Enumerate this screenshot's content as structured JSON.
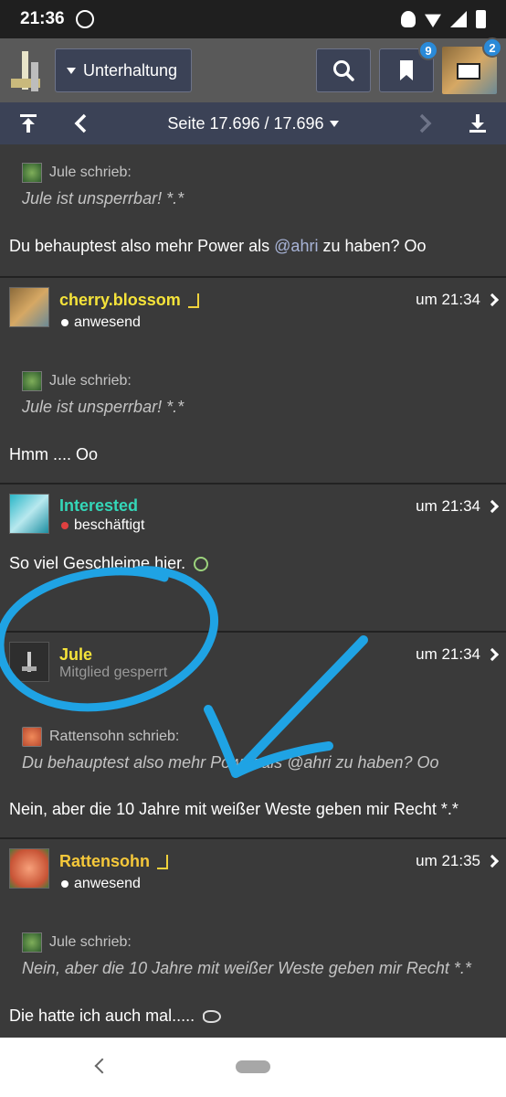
{
  "status_bar": {
    "time": "21:36"
  },
  "top_bar": {
    "forum": "Unterhaltung",
    "bookmark_badge": "9",
    "message_badge": "2"
  },
  "pager": {
    "page_label": "Seite 17.696 / 17.696"
  },
  "posts": [
    {
      "quote_author": "Jule schrieb:",
      "quote_text": "Jule ist unsperrbar! *.*",
      "text_before": "Du behauptest also mehr Power als ",
      "mention": "@ahri",
      "text_after": " zu haben? Oo"
    },
    {
      "user": "cherry.blossom",
      "user_color": "#f5e33a",
      "status": "anwesend",
      "time": "um 21:34",
      "quote_author": "Jule schrieb:",
      "quote_text": "Jule ist unsperrbar! *.*",
      "text": "Hmm .... Oo"
    },
    {
      "user": "Interested",
      "user_color": "#34d6b8",
      "status": "beschäftigt",
      "time": "um 21:34",
      "text": "So viel Geschleime hier."
    },
    {
      "user": "Jule",
      "user_color": "#f5e33a",
      "status": "Mitglied gesperrt",
      "time": "um 21:34",
      "quote_author": "Rattensohn schrieb:",
      "quote_text": "Du behauptest also mehr Power als @ahri zu haben? Oo",
      "text": "Nein, aber die 10 Jahre mit weißer Weste geben mir Recht *.*"
    },
    {
      "user": "Rattensohn",
      "user_color": "#f5c83a",
      "status": "anwesend",
      "time": "um 21:35",
      "quote_author": "Jule schrieb:",
      "quote_text": "Nein, aber die 10 Jahre mit weißer Weste geben mir Recht *.*",
      "text": "Die hatte ich auch mal....."
    }
  ],
  "annotation_color": "#1fa3e4"
}
